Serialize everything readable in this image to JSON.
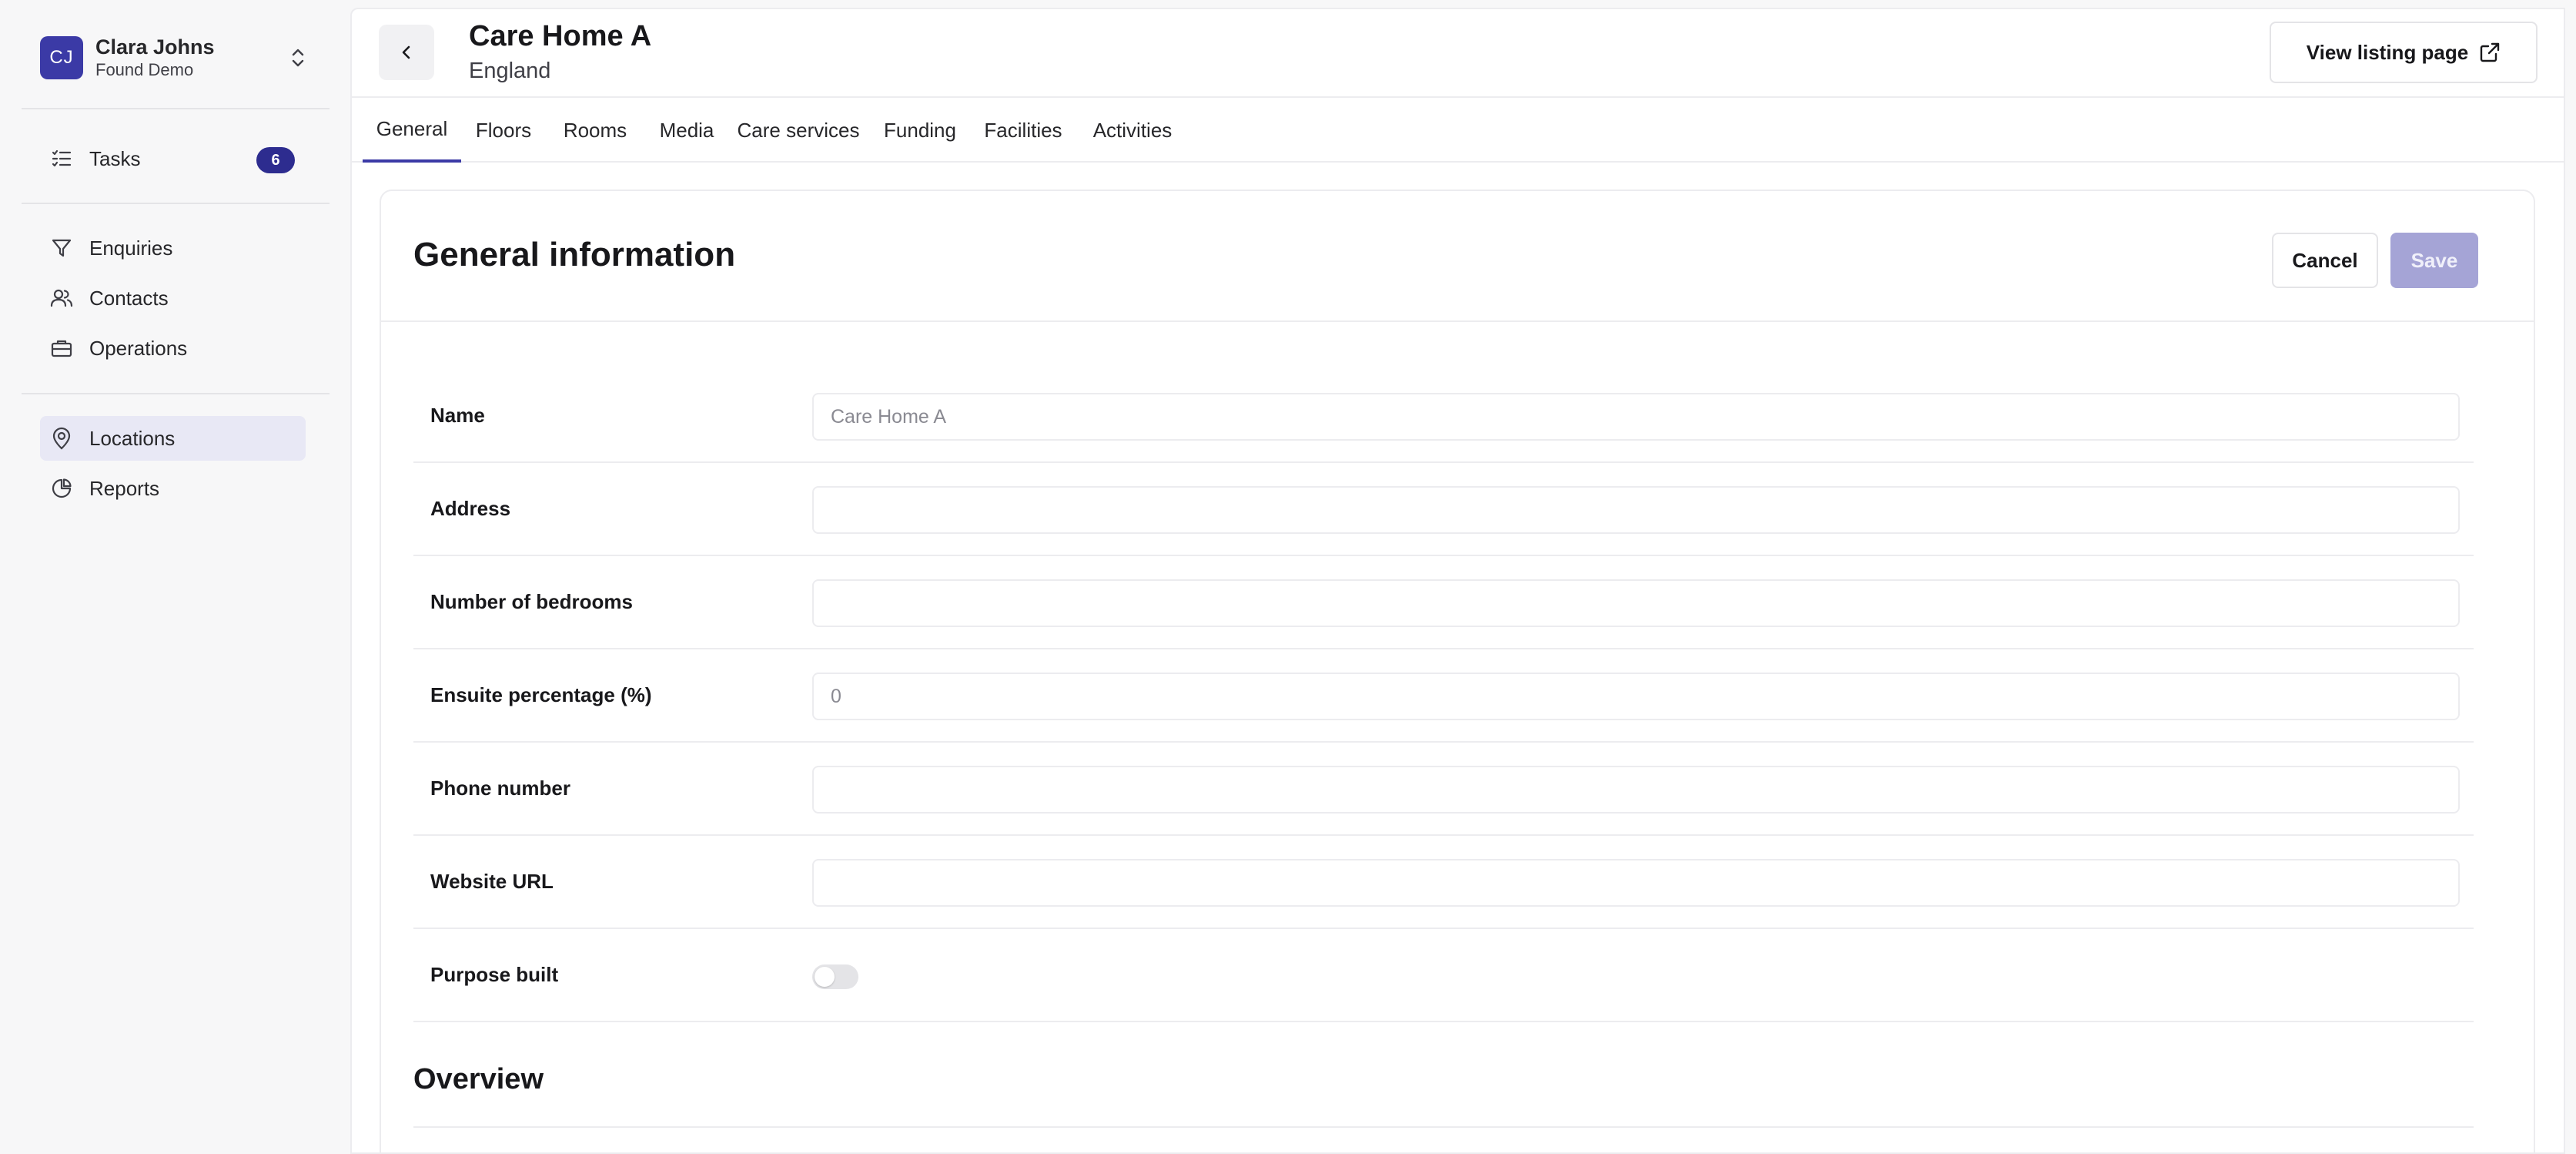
{
  "account": {
    "initials": "CJ",
    "name": "Clara Johns",
    "org": "Found Demo"
  },
  "sidebar": {
    "items": [
      {
        "label": "Tasks",
        "icon": "list-check-icon",
        "badge": "6"
      },
      {
        "label": "Enquiries",
        "icon": "filter-icon"
      },
      {
        "label": "Contacts",
        "icon": "users-icon"
      },
      {
        "label": "Operations",
        "icon": "briefcase-icon"
      },
      {
        "label": "Locations",
        "icon": "map-pin-icon",
        "active": true
      },
      {
        "label": "Reports",
        "icon": "pie-chart-icon"
      }
    ]
  },
  "header": {
    "title": "Care Home A",
    "subtitle": "England",
    "listing_button": "View listing page"
  },
  "tabs": [
    {
      "label": "General",
      "active": true
    },
    {
      "label": "Floors"
    },
    {
      "label": "Rooms"
    },
    {
      "label": "Media"
    },
    {
      "label": "Care services"
    },
    {
      "label": "Funding"
    },
    {
      "label": "Facilities"
    },
    {
      "label": "Activities"
    }
  ],
  "form": {
    "title": "General information",
    "cancel_label": "Cancel",
    "save_label": "Save",
    "fields": [
      {
        "label": "Name",
        "placeholder": "Care Home A",
        "value": ""
      },
      {
        "label": "Address",
        "placeholder": "",
        "value": ""
      },
      {
        "label": "Number of bedrooms",
        "placeholder": "",
        "value": ""
      },
      {
        "label": "Ensuite percentage (%)",
        "placeholder": "0",
        "value": ""
      },
      {
        "label": "Phone number",
        "placeholder": "",
        "value": ""
      },
      {
        "label": "Website URL",
        "placeholder": "",
        "value": ""
      }
    ],
    "purpose_built": {
      "label": "Purpose built",
      "enabled": false
    },
    "overview_title": "Overview"
  },
  "colors": {
    "accent": "#3b3aa6",
    "badge": "#2d2c8f",
    "save_disabled": "#a5a4d6",
    "active_nav_bg": "#e8e8f5"
  }
}
